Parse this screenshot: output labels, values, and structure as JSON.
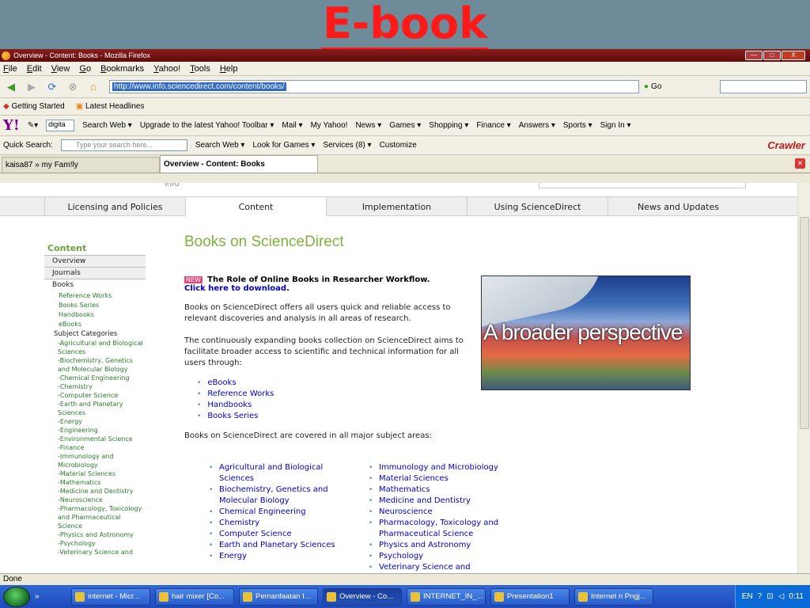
{
  "slide": {
    "title": "E-book"
  },
  "window": {
    "title": "Overview - Content: Books - Mozilla Firefox",
    "buttons": [
      "—",
      "□",
      "X"
    ]
  },
  "menu": [
    "File",
    "Edit",
    "View",
    "Go",
    "Bookmarks",
    "Yahoo!",
    "Tools",
    "Help"
  ],
  "nav": {
    "url": "http://www.info.sciencedirect.com/content/books/",
    "go_label": "Go"
  },
  "bookmarks": [
    "Getting Started",
    "Latest Headlines"
  ],
  "yahoo_bar": {
    "select_value": "digita",
    "items": [
      "Search Web ▾",
      "Upgrade to the latest Yahoo! Toolbar ▾",
      "Mail ▾",
      "My Yahoo!",
      "News ▾",
      "Games ▾",
      "Shopping ▾",
      "Finance ▾",
      "Answers ▾",
      "Sports ▾",
      "Sign In ▾"
    ]
  },
  "quick_search": {
    "label": "Quick Search:",
    "placeholder": "Type your search here...",
    "items": [
      "Search Web ▾",
      "Look for Games ▾",
      "Services (8) ▾",
      "Customize"
    ],
    "brand": "Crawler"
  },
  "tabs": [
    {
      "label": "kaisa87 » my Fam!ly"
    },
    {
      "label": "Overview - Content: Books"
    }
  ],
  "page": {
    "peek": "info",
    "nav_tabs": [
      "",
      "Licensing and Policies",
      "Content",
      "Implementation",
      "Using ScienceDirect",
      "News and Updates"
    ],
    "sidebar": {
      "heading": "Content",
      "top_items": [
        "Overview",
        "Journals"
      ],
      "books_label": "Books",
      "books_items": [
        "Reference Works",
        "Books Series",
        "Handbooks",
        "eBooks"
      ],
      "subject_label": "Subject Categories",
      "subjects": [
        "-Agricultural and Biological Sciences",
        "-Biochemistry, Genetics and Molecular Biology",
        "-Chemical Engineering",
        "-Chemistry",
        "-Computer Science",
        "-Earth and Planetary Sciences",
        "-Energy",
        "-Engineering",
        "-Environmental Science",
        "-Finance",
        "-Immunology and Microbiology",
        "-Material Sciences",
        "-Mathematics",
        "-Medicine and Dentistry",
        "-Neuroscience",
        "-Pharmacology, Toxicology and Pharmaceutical Science",
        "-Physics and Astronomy",
        "-Psychology",
        "-Veterinary Science and"
      ]
    },
    "title": "Books on ScienceDirect",
    "new_badge": "NEW",
    "headline": "The Role of Online Books in Researcher Workflow.",
    "download": "Click here to download.",
    "para1": "Books on ScienceDirect offers all users quick and reliable access to relevant discoveries and analysis in all areas of research.",
    "para2": "The continuously expanding books collection on ScienceDirect aims to facilitate broader access to scientific and technical information for all users through:",
    "list1": [
      "eBooks",
      "Reference Works",
      "Handbooks",
      "Books Series"
    ],
    "para3": "Books on ScienceDirect are covered in all major subject areas:",
    "subjects_col1": [
      "Agricultural and Biological Sciences",
      "Biochemistry, Genetics and Molecular Biology",
      "Chemical Engineering",
      "Chemistry",
      "Computer Science",
      "Earth and Planetary Sciences",
      "Energy"
    ],
    "subjects_col2": [
      "Immunology and Microbiology",
      "Material Sciences",
      "Mathematics",
      "Medicine and Dentistry",
      "Neuroscience",
      "Pharmacology, Toxicology and Pharmaceutical Science",
      "Physics and Astronomy",
      "Psychology",
      "Veterinary Science and"
    ],
    "image_text": "A broader perspective"
  },
  "status": "Done",
  "taskbar": {
    "quick": "»",
    "buttons": [
      "internet - Micr...",
      "hair mixer [Co...",
      "Pemanfaatan I...",
      "Overview - Co...",
      "INTERNET_IN_...",
      "Presentation1",
      "Internet n Pngj..."
    ],
    "lang": "EN",
    "clock": "0:11"
  }
}
